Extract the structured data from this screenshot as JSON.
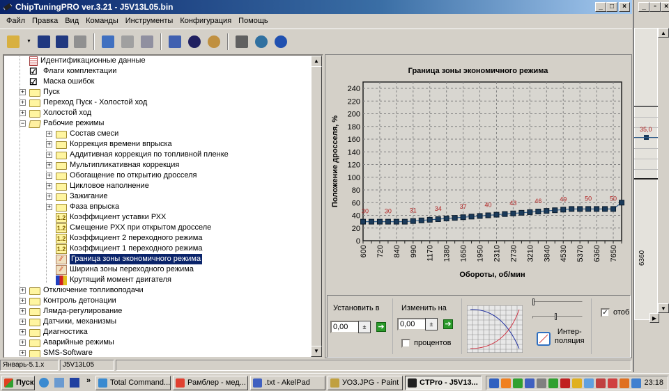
{
  "window": {
    "title": "ChipTuningPRO ver.3.21 - J5V13L05.bin",
    "min": "_",
    "max": "□",
    "close": "×"
  },
  "menu": [
    "Файл",
    "Правка",
    "Вид",
    "Команды",
    "Инструменты",
    "Конфигурация",
    "Помощь"
  ],
  "toolbar": [
    "open-icon",
    "save-icon",
    "save-as-icon",
    "print-icon",
    "copy-icon",
    "paste-icon",
    "undo-icon",
    "compare-icon",
    "info-icon",
    "search-icon",
    "tools-icon",
    "network-icon",
    "help-icon"
  ],
  "tree": [
    {
      "label": "Идентификационные данные",
      "level": 0,
      "icon": "document",
      "exp": ""
    },
    {
      "label": "Флаги комплектации",
      "level": 0,
      "icon": "check",
      "exp": ""
    },
    {
      "label": "Маска ошибок",
      "level": 0,
      "icon": "check",
      "exp": ""
    },
    {
      "label": "Пуск",
      "level": 0,
      "icon": "folder",
      "exp": "+"
    },
    {
      "label": "Переход Пуск - Холостой ход",
      "level": 0,
      "icon": "folder",
      "exp": "+"
    },
    {
      "label": "Холостой ход",
      "level": 0,
      "icon": "folder",
      "exp": "+"
    },
    {
      "label": "Рабочие режимы",
      "level": 0,
      "icon": "folder-open",
      "exp": "-"
    },
    {
      "label": "Состав смеси",
      "level": 1,
      "icon": "folder",
      "exp": "+"
    },
    {
      "label": "Коррекция времени впрыска",
      "level": 1,
      "icon": "folder",
      "exp": "+"
    },
    {
      "label": "Аддитивная коррекция по топливной пленке",
      "level": 1,
      "icon": "folder",
      "exp": "+"
    },
    {
      "label": "Мультипликативная коррекция",
      "level": 1,
      "icon": "folder",
      "exp": "+"
    },
    {
      "label": "Обогащение по открытию дросселя",
      "level": 1,
      "icon": "folder",
      "exp": "+"
    },
    {
      "label": "Цикловое наполнение",
      "level": 1,
      "icon": "folder",
      "exp": "+"
    },
    {
      "label": "Зажигание",
      "level": 1,
      "icon": "folder",
      "exp": "+"
    },
    {
      "label": "Фаза впрыска",
      "level": 1,
      "icon": "folder",
      "exp": "+"
    },
    {
      "label": "Коэффициент уставки РХХ",
      "level": 1,
      "icon": "constant",
      "exp": ""
    },
    {
      "label": "Смещение РХХ при открытом дросселе",
      "level": 1,
      "icon": "constant",
      "exp": ""
    },
    {
      "label": "Коэффициент 2 переходного режима",
      "level": 1,
      "icon": "constant",
      "exp": ""
    },
    {
      "label": "Коэффициент 1 переходного режима",
      "level": 1,
      "icon": "constant",
      "exp": ""
    },
    {
      "label": "Граница зоны экономичного режима",
      "level": 1,
      "icon": "curve",
      "exp": "",
      "selected": true
    },
    {
      "label": "Ширина зоны переходного режима",
      "level": 1,
      "icon": "curve",
      "exp": ""
    },
    {
      "label": "Крутящий момент двигателя",
      "level": 1,
      "icon": "bars",
      "exp": ""
    },
    {
      "label": "Отключение топливоподачи",
      "level": 0,
      "icon": "folder",
      "exp": "+"
    },
    {
      "label": "Контроль детонации",
      "level": 0,
      "icon": "folder",
      "exp": "+"
    },
    {
      "label": "Лямда-регулирование",
      "level": 0,
      "icon": "folder",
      "exp": "+"
    },
    {
      "label": "Датчики, механизмы",
      "level": 0,
      "icon": "folder",
      "exp": "+"
    },
    {
      "label": "Диагностика",
      "level": 0,
      "icon": "folder",
      "exp": "+"
    },
    {
      "label": "Аварийные режимы",
      "level": 0,
      "icon": "folder",
      "exp": "+"
    },
    {
      "label": "SMS-Software",
      "level": 0,
      "icon": "folder",
      "exp": "+"
    }
  ],
  "chart_data": {
    "type": "line",
    "title": "Граница зоны экономичного режима",
    "xlabel": "Обороты, об/мин",
    "ylabel": "Положение дросселя, %",
    "x_tick_labels": [
      "600",
      "720",
      "840",
      "990",
      "1170",
      "1380",
      "1650",
      "1950",
      "2310",
      "2730",
      "3210",
      "3840",
      "4530",
      "5370",
      "6360",
      "7650"
    ],
    "x": [
      600,
      660,
      720,
      780,
      840,
      910,
      990,
      1080,
      1170,
      1270,
      1380,
      1510,
      1650,
      1800,
      1950,
      2120,
      2310,
      2520,
      2730,
      2960,
      3210,
      3510,
      3840,
      4180,
      4530,
      4940,
      5370,
      5850,
      6360,
      6990,
      7650,
      8000
    ],
    "values": [
      30,
      30,
      30,
      30,
      30,
      30,
      31,
      32,
      33,
      34,
      35,
      36,
      37,
      38,
      39,
      40,
      41,
      42,
      43,
      44,
      45,
      46,
      47,
      48,
      49,
      50,
      50,
      50,
      50,
      50,
      50,
      60
    ],
    "data_labels_every": 3,
    "yticks": [
      0,
      20,
      40,
      60,
      80,
      100,
      120,
      140,
      160,
      180,
      200,
      220,
      240
    ],
    "ylim": [
      0,
      250
    ],
    "grid": true,
    "line_color": "#2a5a8a",
    "marker_color": "#1a3a5a",
    "label_color": "#b02020"
  },
  "controls": {
    "set_label": "Установить в",
    "set_value": "0,00",
    "change_label": "Изменить на",
    "change_value": "0,00",
    "percent_label": "процентов",
    "percent_checked": false,
    "interp_label1": "Интер-",
    "interp_label2": "поляция",
    "display_label": "отобр",
    "display_checked": true
  },
  "background_window": {
    "point_label": "35,0",
    "x_tick": "6360"
  },
  "status": {
    "left": "Январь-5.1.x",
    "right": "J5V13L05"
  },
  "taskbar": {
    "start": "Пуск",
    "tasks": [
      {
        "label": "Total Command...",
        "color": "#3a8ad0"
      },
      {
        "label": "Рамблер - мед...",
        "color": "#e04030"
      },
      {
        "label": ".txt - AkelPad",
        "color": "#4060c0"
      },
      {
        "label": "УОЗ.JPG - Paint",
        "color": "#c0a040"
      },
      {
        "label": "CTPro - J5V13...",
        "color": "#202020",
        "active": true
      }
    ],
    "clock": "23:18",
    "more": "»"
  }
}
